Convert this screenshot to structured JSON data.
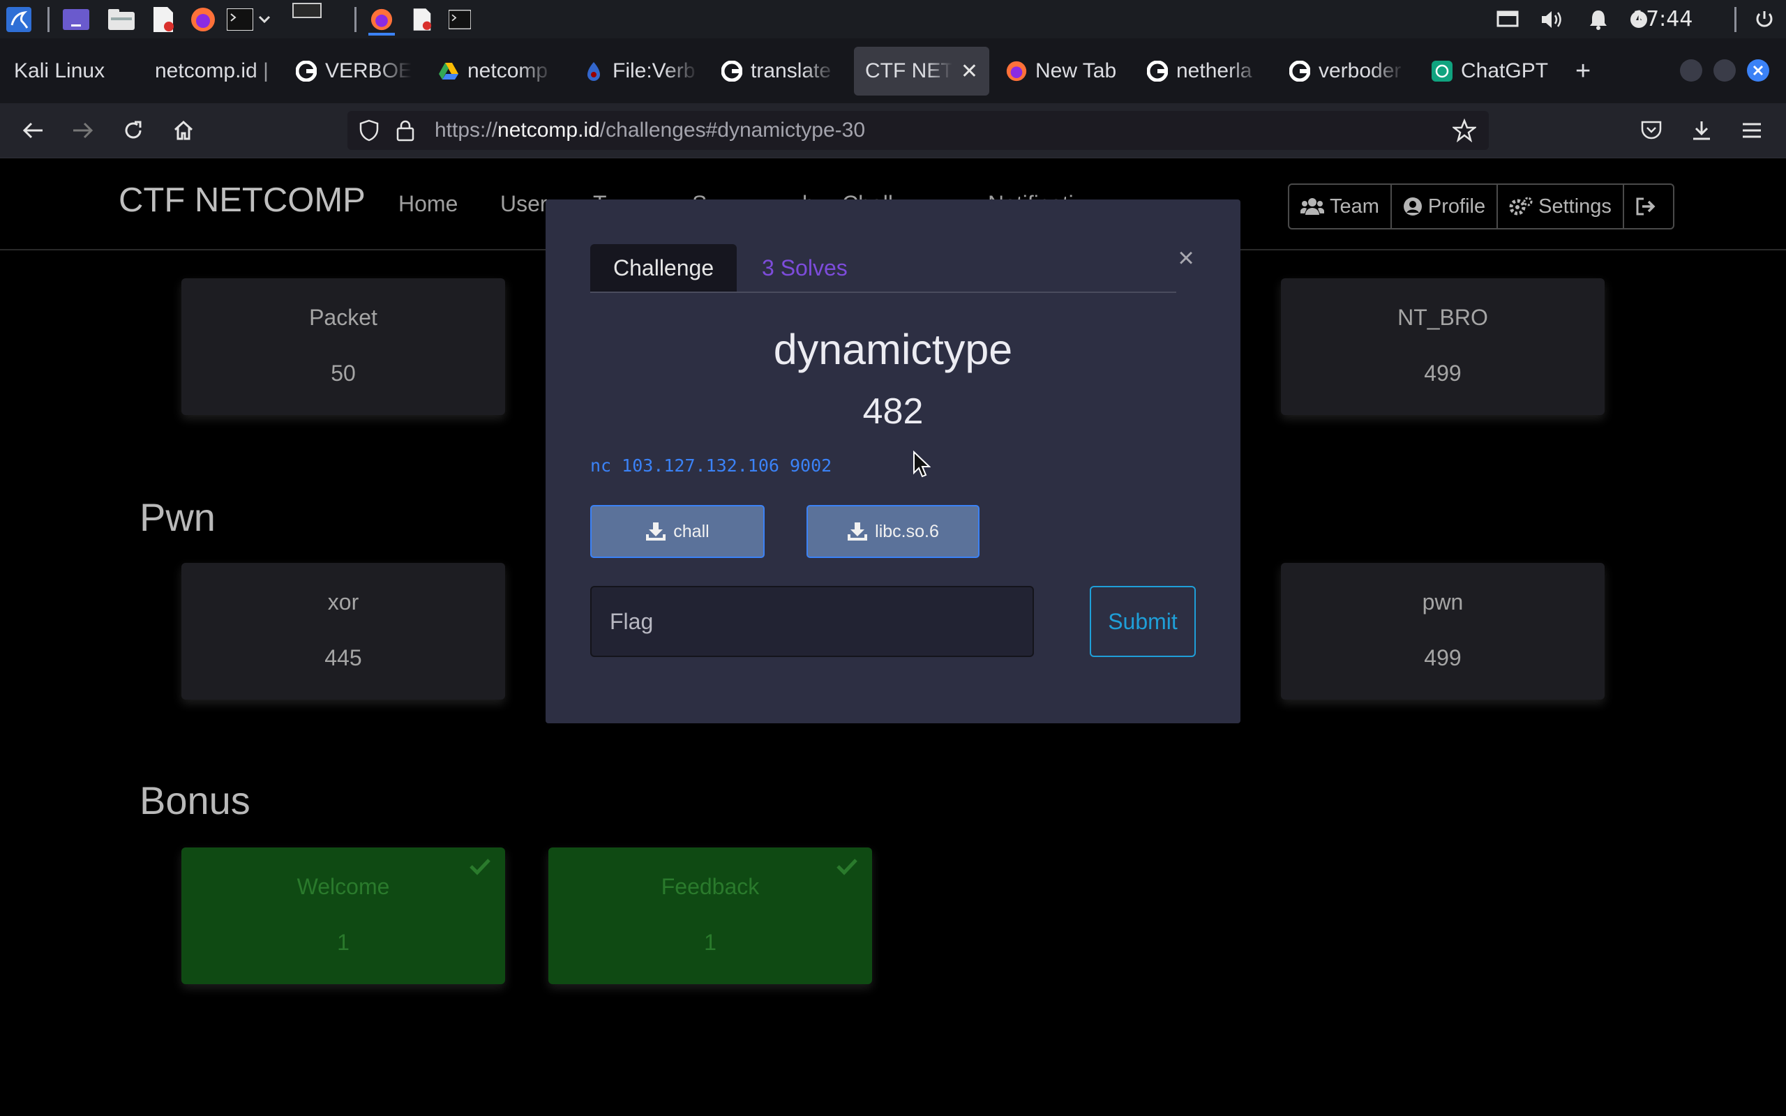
{
  "taskbar": {
    "clock": "17:44"
  },
  "browser": {
    "tabs": [
      {
        "label": "Kali Linux"
      },
      {
        "label": "netcomp.id |"
      },
      {
        "label": "VERBOE"
      },
      {
        "label": "netcomp"
      },
      {
        "label": "File:Verb"
      },
      {
        "label": "translate"
      },
      {
        "label": "CTF NETC"
      },
      {
        "label": "New Tab"
      },
      {
        "label": "netherla"
      },
      {
        "label": "verboder"
      },
      {
        "label": "ChatGPT"
      }
    ],
    "url": {
      "prefix": "https://",
      "host": "netcomp.id",
      "path": "/challenges#dynamictype-30"
    }
  },
  "site": {
    "brand": "CTF NETCOMP",
    "menu": [
      "Home",
      "User",
      "T",
      "S",
      "b",
      "Chall",
      "Notificati"
    ],
    "user_buttons": {
      "team": "Team",
      "profile": "Profile",
      "settings": "Settings"
    }
  },
  "board": {
    "categories": [
      {
        "title": "",
        "cards": [
          {
            "name": "Packet",
            "value": "50"
          },
          {
            "name": "NT_BRO",
            "value": "499"
          }
        ]
      },
      {
        "title": "Pwn",
        "cards": [
          {
            "name": "xor",
            "value": "445"
          },
          {
            "name": "pwn",
            "value": "499"
          }
        ]
      },
      {
        "title": "Bonus",
        "cards": [
          {
            "name": "Welcome",
            "value": "1",
            "solved": true
          },
          {
            "name": "Feedback",
            "value": "1",
            "solved": true
          }
        ]
      }
    ]
  },
  "modal": {
    "tab_challenge": "Challenge",
    "tab_solves": "3 Solves",
    "close": "×",
    "name": "dynamictype",
    "value": "482",
    "description": "nc 103.127.132.106 9002",
    "files": [
      "chall",
      "libc.so.6"
    ],
    "flag_placeholder": "Flag",
    "submit_label": "Submit"
  },
  "colors": {
    "modal_bg": "#2d2f43",
    "solves_link": "#7d4cdb",
    "desc_blue": "#3b82f6",
    "submit_blue": "#1f9fd8",
    "solved_card": "#0f4a13"
  }
}
